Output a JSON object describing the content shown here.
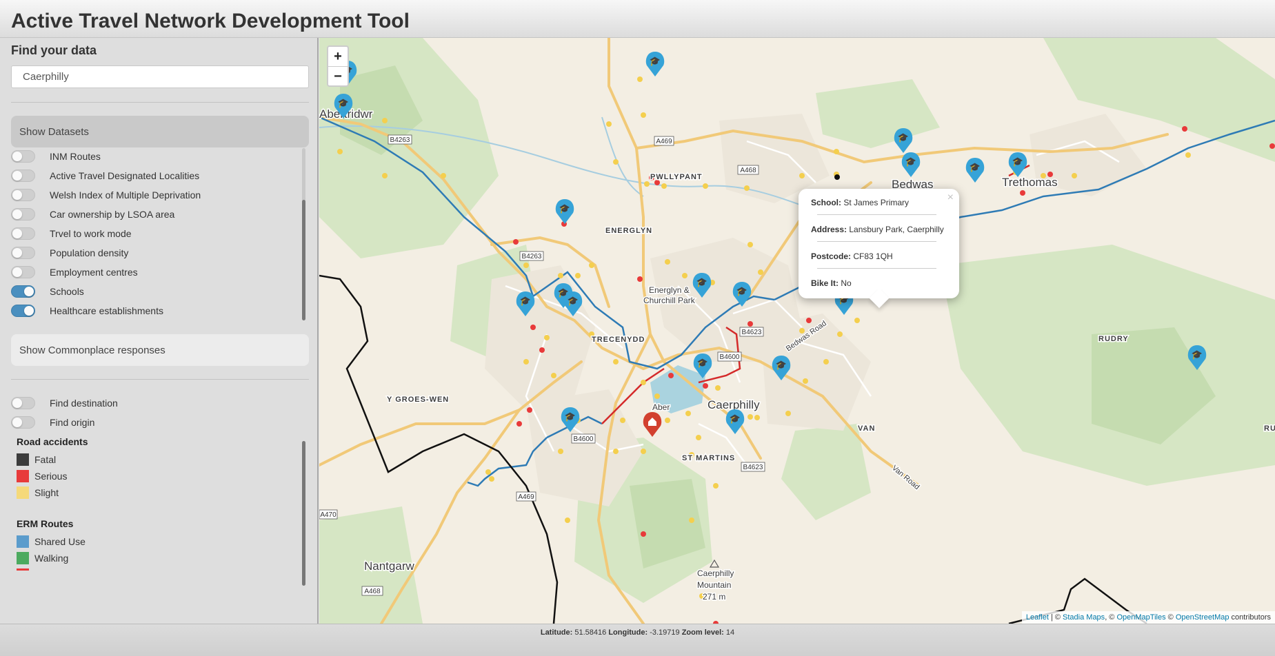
{
  "app": {
    "title": "Active Travel Network Development Tool"
  },
  "sidebar": {
    "find_label": "Find your data",
    "search_value": "Caerphilly",
    "show_datasets_label": "Show Datasets",
    "datasets": [
      {
        "label": "INM Routes",
        "on": false
      },
      {
        "label": "Active Travel Designated Localities",
        "on": false
      },
      {
        "label": "Welsh Index of Multiple Deprivation",
        "on": false
      },
      {
        "label": "Car ownership by LSOA area",
        "on": false
      },
      {
        "label": "Trvel to work mode",
        "on": false
      },
      {
        "label": "Population density",
        "on": false
      },
      {
        "label": "Employment centres",
        "on": false
      },
      {
        "label": "Schools",
        "on": true
      },
      {
        "label": "Healthcare establishments",
        "on": true
      }
    ],
    "commonplace_label": "Show Commonplace responses",
    "find_destination_label": "Find destination",
    "find_origin_label": "Find origin",
    "legend": {
      "road_accidents_title": "Road accidents",
      "road_accidents": [
        {
          "label": "Fatal",
          "color": "#3c3c3c"
        },
        {
          "label": "Serious",
          "color": "#e83a3a"
        },
        {
          "label": "Slight",
          "color": "#f5d97a"
        }
      ],
      "erm_title": "ERM Routes",
      "erm": [
        {
          "label": "Shared Use",
          "color": "#5b9ccc"
        },
        {
          "label": "Walking",
          "color": "#4caa5f"
        }
      ]
    }
  },
  "map": {
    "zoom_in": "+",
    "zoom_out": "−",
    "place_labels": {
      "abertridwr": "Abertridwr",
      "pwllypant": "PWLLYPANT",
      "energlyn": "ENERGLYN",
      "bedwas": "Bedwas",
      "trethomas": "Trethomas",
      "rudry": "RUDRY",
      "energlyn_park": "Energlyn &",
      "churchill_park": "Churchill Park",
      "trecenydd": "TRECENYDD",
      "y_groes_wen": "Y GROES-WEN",
      "aber": "Aber",
      "caerphilly": "Caerphilly",
      "van": "VAN",
      "van_road": "Van Road",
      "bedwas_road": "Bedwas Road",
      "st_martins": "ST MARTINS",
      "nantgarw": "Nantgarw",
      "mountain": "Caerphilly",
      "mountain2": "Mountain",
      "mountain_height": "271 m",
      "ru": "RU"
    },
    "road_labels": {
      "b4263_a": "B4263",
      "a469_a": "A469",
      "a468_a": "A468",
      "b4263_b": "B4263",
      "b4623_a": "B4623",
      "b4600_a": "B4600",
      "b4600_b": "B4600",
      "b4623_b": "B4623",
      "a469_b": "A469",
      "a470": "A470",
      "a468_b": "A468"
    },
    "popup": {
      "school_label": "School:",
      "school_value": "St James Primary",
      "address_label": "Address:",
      "address_value": "Lansbury Park, Caerphilly",
      "postcode_label": "Postcode:",
      "postcode_value": "CF83 1QH",
      "bikeit_label": "Bike It:",
      "bikeit_value": "No",
      "close": "×"
    },
    "attribution": {
      "leaflet": "Leaflet",
      "sep1": " | © ",
      "stadia": "Stadia Maps",
      "sep2": ", © ",
      "openmaptiles": "OpenMapTiles",
      "sep3": " © ",
      "osm": "OpenStreetMap",
      "tail": " contributors"
    }
  },
  "footer": {
    "lat_label": "Latitude:",
    "lat_value": "51.58416",
    "lon_label": "Longitude:",
    "lon_value": "-3.19719",
    "zoom_label": "Zoom level:",
    "zoom_value": "14"
  }
}
